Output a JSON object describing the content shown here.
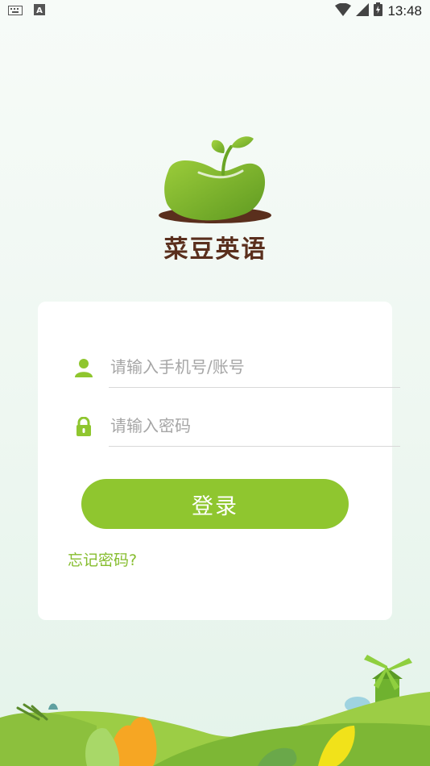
{
  "status_bar": {
    "time": "13:48",
    "icons": [
      "keyboard-icon",
      "a-notification-icon",
      "wifi-icon",
      "signal-icon",
      "battery-charging-icon"
    ]
  },
  "app": {
    "name": "菜豆英语",
    "logo": "bean-sprout-logo"
  },
  "login_form": {
    "account_placeholder": "请输入手机号/账号",
    "account_value": "",
    "account_icon": "user-icon",
    "password_placeholder": "请输入密码",
    "password_value": "",
    "password_icon": "lock-icon",
    "login_label": "登录",
    "forgot_label": "忘记密码?"
  },
  "colors": {
    "accent": "#8fc62f",
    "link": "#86bd2e",
    "brand_text": "#5a2f1d"
  }
}
